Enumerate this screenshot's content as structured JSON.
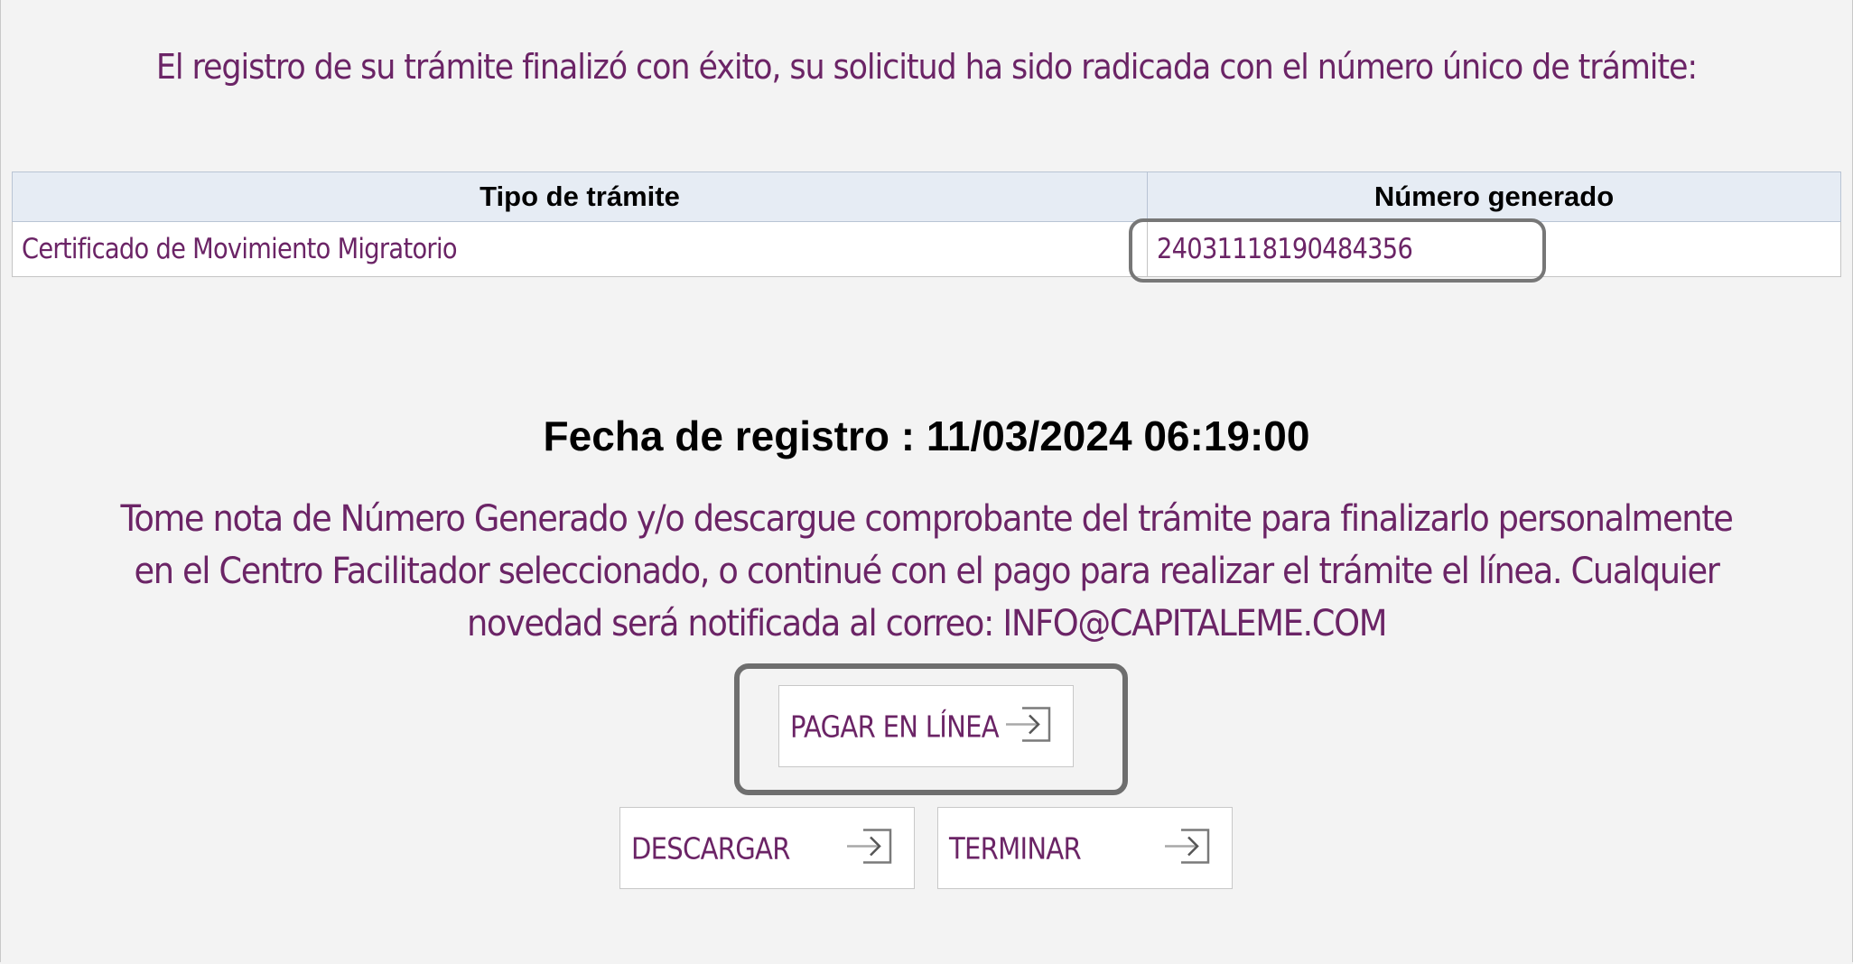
{
  "header": {
    "success_message": "El registro de su trámite finalizó con éxito, su solicitud ha sido radicada con el número único de trámite:"
  },
  "result_table": {
    "columns": [
      "Tipo de trámite",
      "Número generado"
    ],
    "rows": [
      [
        "Certificado de Movimiento Migratorio",
        "24031118190484356"
      ]
    ]
  },
  "registration": {
    "label": "Fecha de registro : 11/03/2024 06:19:00"
  },
  "note": {
    "text": "Tome nota de Número Generado y/o descargue comprobante del trámite para finalizarlo personalmente en el Centro Facilitador seleccionado, o continué con el pago para realizar el trámite el línea. Cualquier novedad será notificada al correo: INFO@CAPITALEME.COM"
  },
  "actions": {
    "pay_online": {
      "label": "PAGAR EN LÍNEA",
      "icon": "sign-in-arrow-icon"
    },
    "download": {
      "label": "DESCARGAR",
      "icon": "sign-in-arrow-icon"
    },
    "finish": {
      "label": "TERMINAR",
      "icon": "sign-in-arrow-icon"
    }
  },
  "colors": {
    "text_accent": "#6b2466",
    "table_header_bg": "#e6ecf4",
    "page_bg": "#f3f3f3",
    "highlight_border": "#6e6e6e"
  }
}
